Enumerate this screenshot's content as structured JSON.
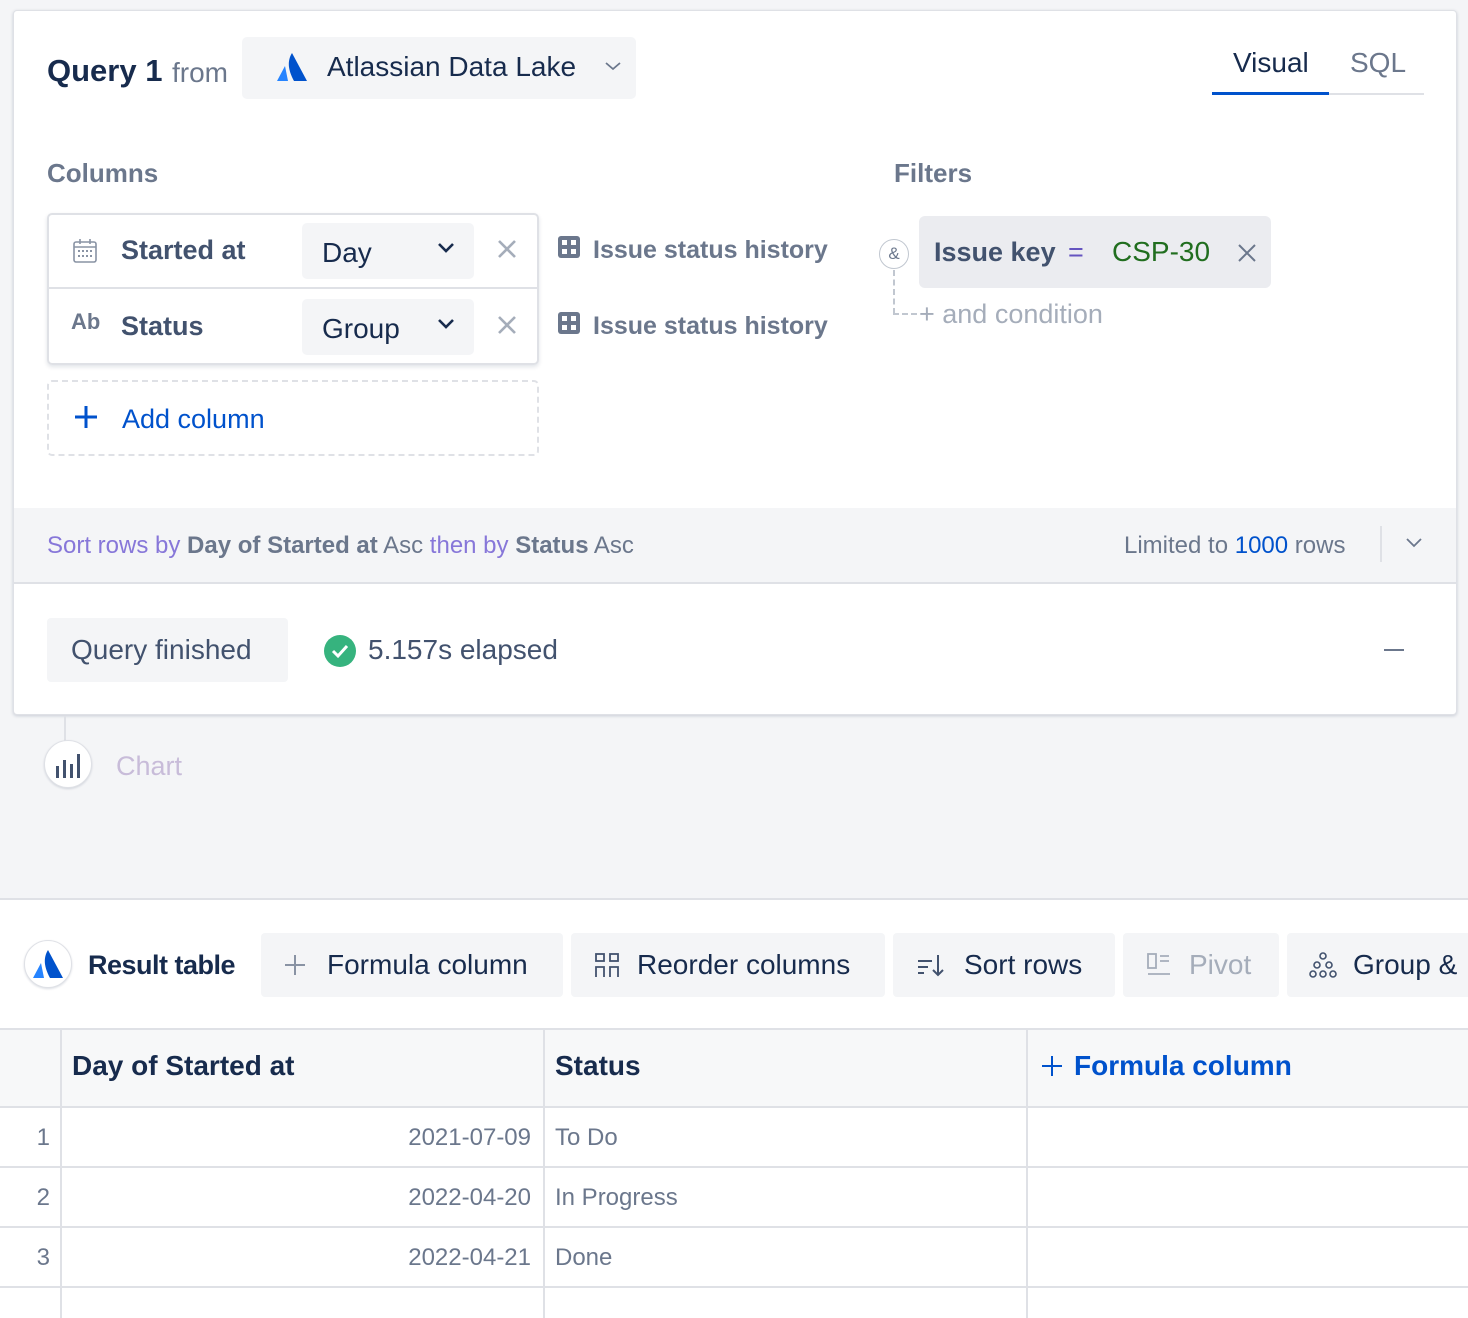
{
  "query": {
    "title": "Query 1",
    "from_label": "from",
    "source": "Atlassian Data Lake",
    "tabs": [
      "Visual",
      "SQL"
    ],
    "active_tab": "Visual"
  },
  "columns_section": {
    "label": "Columns",
    "items": [
      {
        "name": "Started at",
        "icon": "calendar-icon",
        "aggregation": "Day",
        "table": "Issue status history"
      },
      {
        "name": "Status",
        "icon": "text-type-icon",
        "type_label": "Ab",
        "aggregation": "Group",
        "table": "Issue status history"
      }
    ],
    "add_label": "Add column"
  },
  "filters_section": {
    "label": "Filters",
    "connector": "&",
    "filter": {
      "field": "Issue key",
      "operator": "=",
      "value": "CSP-30"
    },
    "add_condition": "+ and condition"
  },
  "sort_bar": {
    "prefix": "Sort rows by",
    "field1": "Day of Started at",
    "dir1": "Asc",
    "then": "then by",
    "field2": "Status",
    "dir2": "Asc",
    "limit_prefix": "Limited to",
    "limit_value": "1000",
    "limit_suffix": "rows"
  },
  "status": {
    "label": "Query finished",
    "elapsed": "5.157s elapsed"
  },
  "chart_step": {
    "label": "Chart"
  },
  "result": {
    "label": "Result table",
    "toolbar": [
      {
        "label": "Formula column",
        "icon": "plus-icon",
        "disabled": false
      },
      {
        "label": "Reorder columns",
        "icon": "reorder-icon",
        "disabled": false
      },
      {
        "label": "Sort rows",
        "icon": "sort-icon",
        "disabled": false
      },
      {
        "label": "Pivot",
        "icon": "pivot-icon",
        "disabled": true
      },
      {
        "label": "Group &",
        "icon": "group-icon",
        "disabled": false
      }
    ],
    "headers": [
      "Day of Started at",
      "Status"
    ],
    "formula_header": "Formula column",
    "rows": [
      {
        "n": "1",
        "date": "2021-07-09",
        "status": "To Do"
      },
      {
        "n": "2",
        "date": "2022-04-20",
        "status": "In Progress"
      },
      {
        "n": "3",
        "date": "2022-04-21",
        "status": "Done"
      }
    ]
  },
  "colors": {
    "accent": "#0052cc",
    "success": "#36b37e",
    "filter_value": "#216e1f",
    "operator": "#6554c0"
  }
}
